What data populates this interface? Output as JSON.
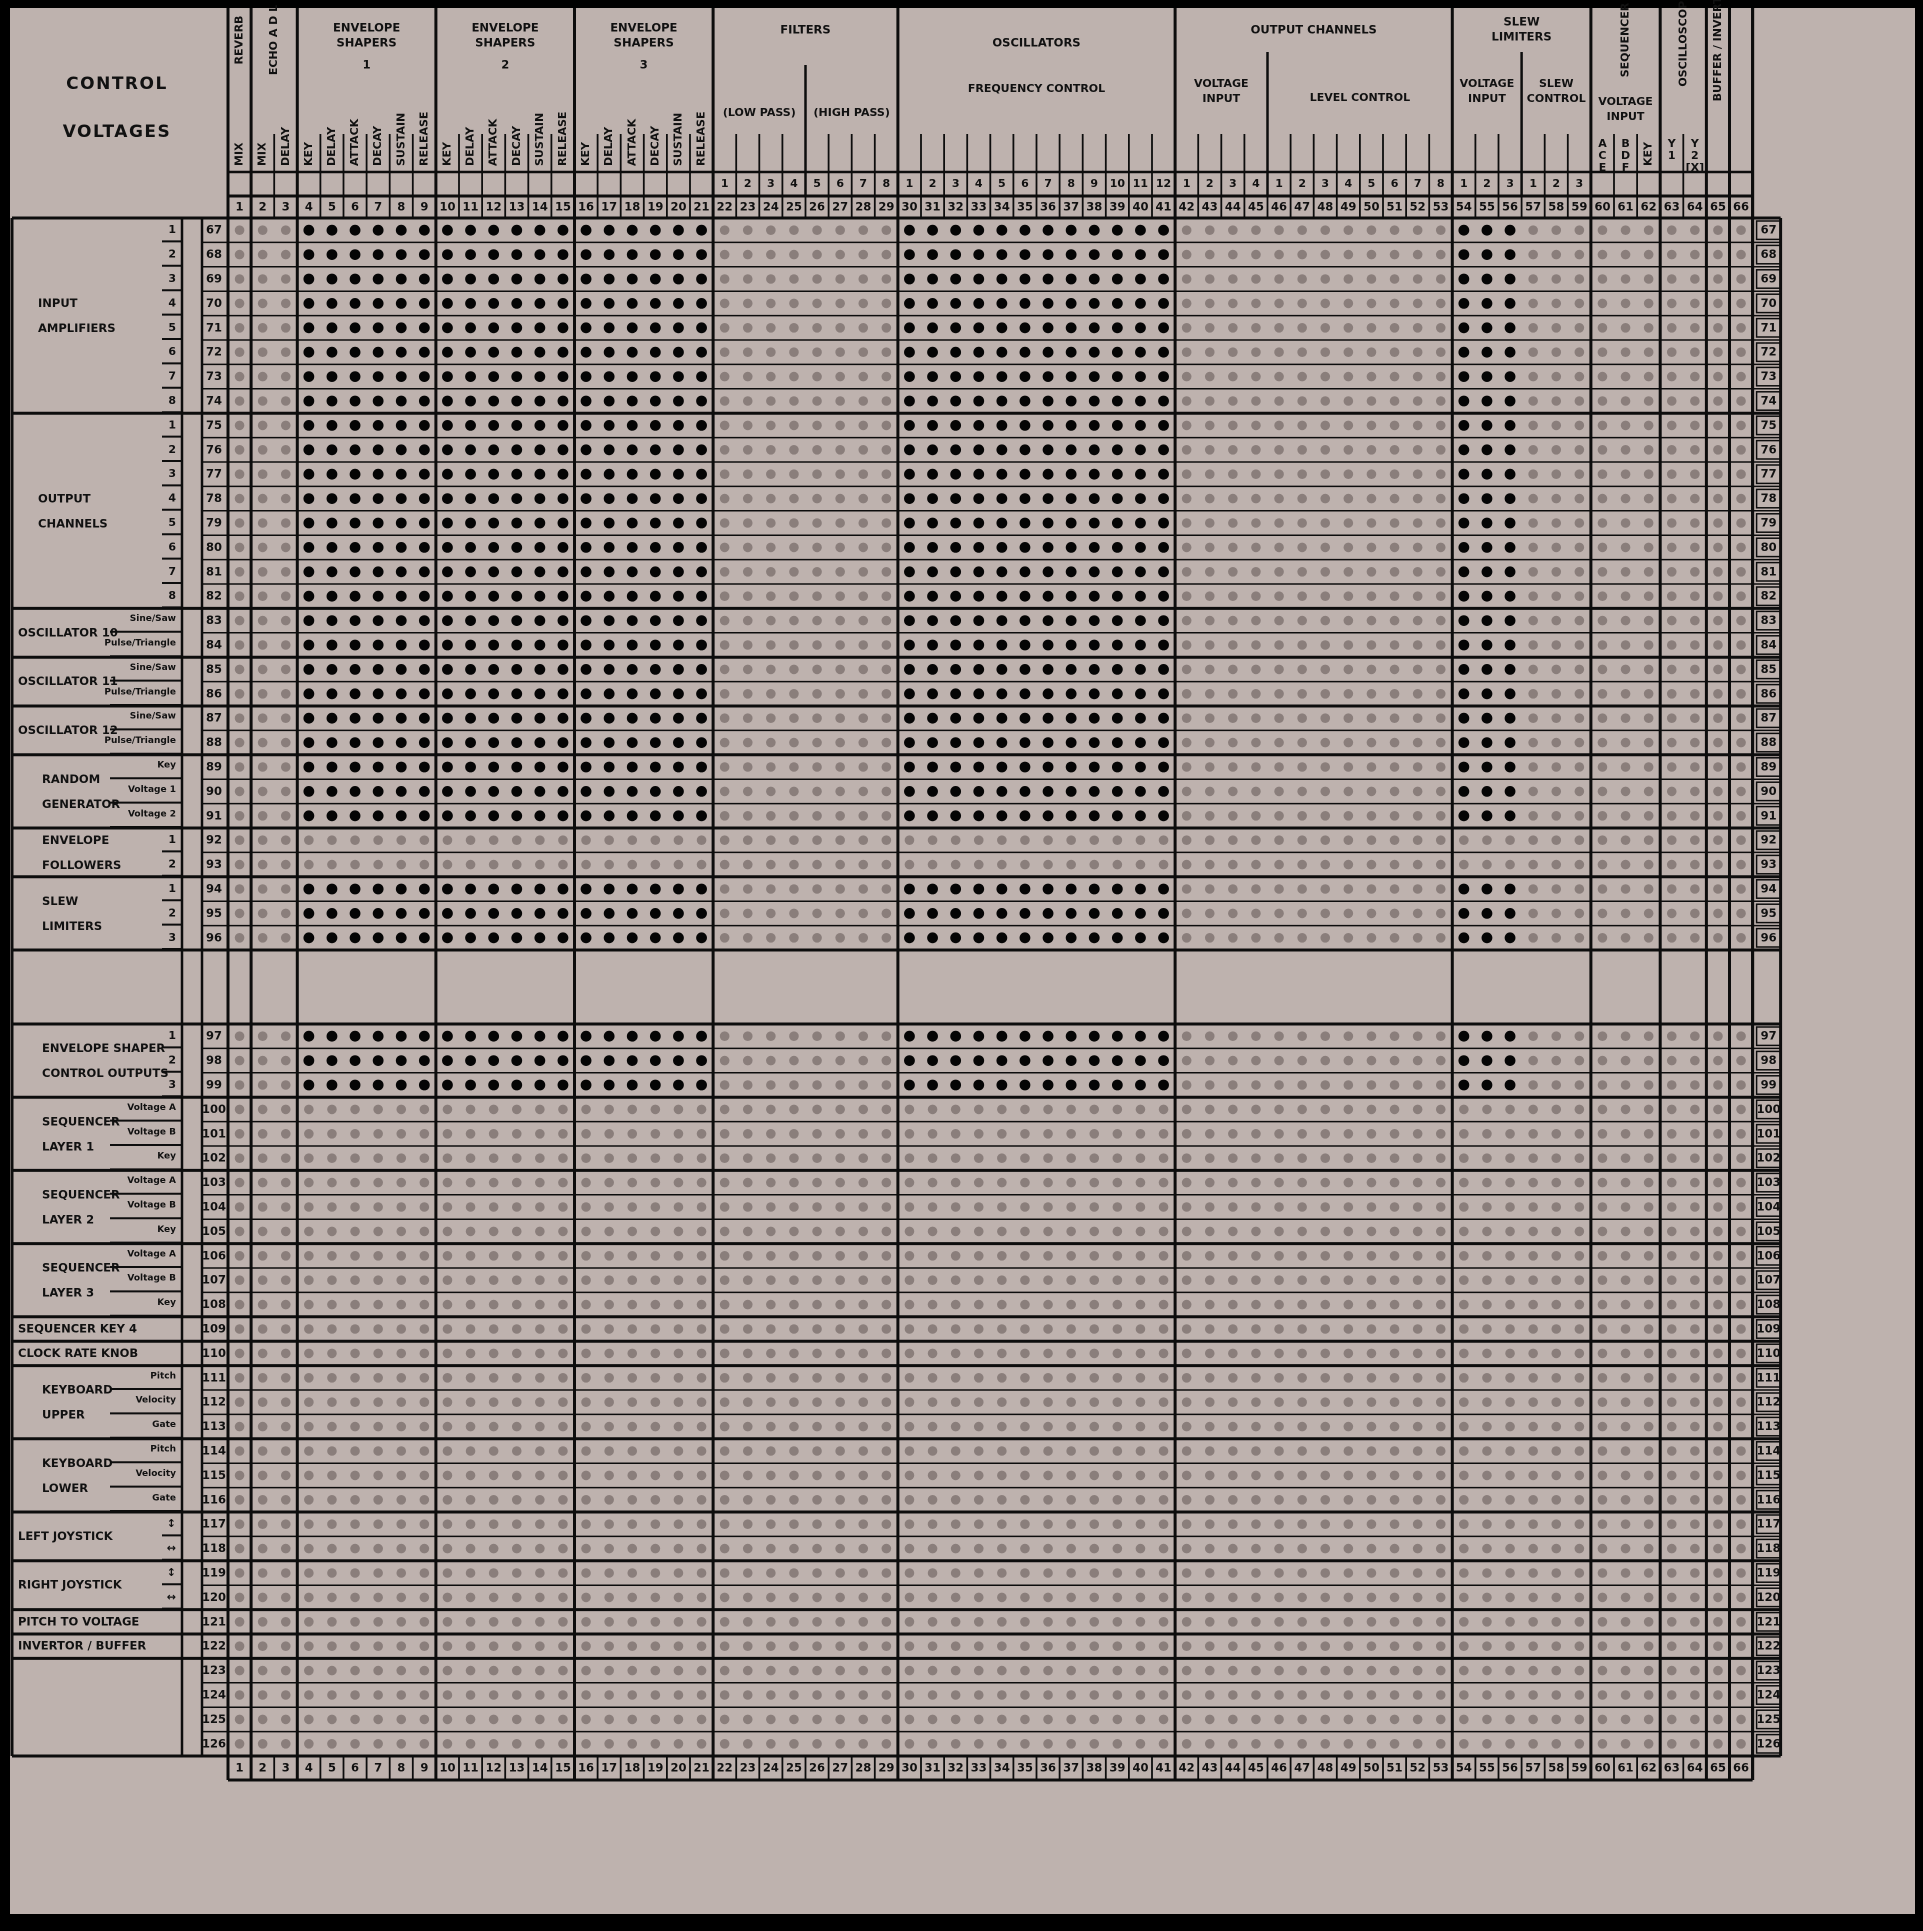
{
  "title": [
    "CONTROL",
    "VOLTAGES"
  ],
  "colors": {
    "panel": "#beb2ae",
    "line": "#0d0d0d",
    "active_pin": "#050505",
    "inactive_pin": "#8a7e7b"
  },
  "column_count": 66,
  "groups": [
    {
      "label": [
        "FILTERS"
      ],
      "cols": [
        22,
        29
      ]
    },
    {
      "label": [
        "OSCILLATORS"
      ],
      "cols": [
        30,
        41
      ]
    },
    {
      "label": [
        "OUTPUT CHANNELS"
      ],
      "cols": [
        42,
        53
      ]
    },
    {
      "label": [
        "SLEW",
        "LIMITERS"
      ],
      "cols": [
        54,
        59
      ]
    },
    {
      "label": [
        "ENVELOPE",
        "SHAPERS",
        "1"
      ],
      "cols": [
        4,
        9
      ]
    },
    {
      "label": [
        "ENVELOPE",
        "SHAPERS",
        "2"
      ],
      "cols": [
        10,
        15
      ]
    },
    {
      "label": [
        "ENVELOPE",
        "SHAPERS",
        "3"
      ],
      "cols": [
        16,
        21
      ]
    }
  ],
  "subgroups": [
    {
      "label": [
        "(LOW PASS)"
      ],
      "cols": [
        22,
        25
      ]
    },
    {
      "label": [
        "(HIGH PASS)"
      ],
      "cols": [
        26,
        29
      ]
    },
    {
      "label": [
        "FREQUENCY CONTROL"
      ],
      "cols": [
        30,
        41
      ]
    },
    {
      "label": [
        "VOLTAGE",
        "INPUT"
      ],
      "cols": [
        42,
        45
      ]
    },
    {
      "label": [
        "LEVEL CONTROL"
      ],
      "cols": [
        46,
        53
      ]
    },
    {
      "label": [
        "VOLTAGE",
        "INPUT"
      ],
      "cols": [
        54,
        56
      ]
    },
    {
      "label": [
        "SLEW",
        "CONTROL"
      ],
      "cols": [
        57,
        59
      ]
    },
    {
      "label": [
        "VOLTAGE",
        "INPUT"
      ],
      "cols": [
        60,
        62
      ]
    }
  ],
  "vertical_group_labels": [
    {
      "text": "REVERB",
      "cols": [
        1,
        1
      ]
    },
    {
      "text": "ECHO A D L",
      "cols": [
        2,
        3
      ]
    },
    {
      "text": "SEQUENCER",
      "cols": [
        60,
        62
      ]
    },
    {
      "text": "OSCILLOSCOPE",
      "cols": [
        63,
        64
      ]
    },
    {
      "text": "BUFFER / INVERTOR",
      "cols": [
        65,
        65
      ]
    }
  ],
  "column_labels": [
    "MIX",
    "MIX",
    "DELAY",
    "KEY",
    "DELAY",
    "ATTACK",
    "DECAY",
    "SUSTAIN",
    "RELEASE",
    "KEY",
    "DELAY",
    "ATTACK",
    "DECAY",
    "SUSTAIN",
    "RELEASE",
    "KEY",
    "DELAY",
    "ATTACK",
    "DECAY",
    "SUSTAIN",
    "RELEASE",
    "1",
    "2",
    "3",
    "4",
    "5",
    "6",
    "7",
    "8",
    "1",
    "2",
    "3",
    "4",
    "5",
    "6",
    "7",
    "8",
    "9",
    "10",
    "11",
    "12",
    "1",
    "2",
    "3",
    "4",
    "1",
    "2",
    "3",
    "4",
    "5",
    "6",
    "7",
    "8",
    "1",
    "2",
    "3",
    "1",
    "2",
    "3",
    "A C E",
    "B D F",
    "KEY",
    "Y 1",
    "Y 2 [X]",
    "",
    ""
  ],
  "column_numbers": [
    "1",
    "2",
    "3",
    "4",
    "5",
    "6",
    "7",
    "8",
    "9",
    "10",
    "11",
    "12",
    "13",
    "14",
    "15",
    "16",
    "17",
    "18",
    "19",
    "20",
    "21",
    "22",
    "23",
    "24",
    "25",
    "26",
    "27",
    "28",
    "29",
    "30",
    "31",
    "32",
    "33",
    "34",
    "35",
    "36",
    "37",
    "38",
    "39",
    "40",
    "41",
    "42",
    "43",
    "44",
    "45",
    "46",
    "47",
    "48",
    "49",
    "50",
    "51",
    "52",
    "53",
    "54",
    "55",
    "56",
    "57",
    "58",
    "59",
    "60",
    "61",
    "62",
    "63",
    "64",
    "65",
    "66"
  ],
  "sections": [
    {
      "name": [
        "INPUT",
        "AMPLIFIERS"
      ],
      "rows": [
        {
          "sub": "1",
          "num": "67"
        },
        {
          "sub": "2",
          "num": "68"
        },
        {
          "sub": "3",
          "num": "69"
        },
        {
          "sub": "4",
          "num": "70"
        },
        {
          "sub": "5",
          "num": "71"
        },
        {
          "sub": "6",
          "num": "72"
        },
        {
          "sub": "7",
          "num": "73"
        },
        {
          "sub": "8",
          "num": "74"
        }
      ],
      "active": true
    },
    {
      "name": [
        "OUTPUT",
        "CHANNELS"
      ],
      "rows": [
        {
          "sub": "1",
          "num": "75"
        },
        {
          "sub": "2",
          "num": "76"
        },
        {
          "sub": "3",
          "num": "77"
        },
        {
          "sub": "4",
          "num": "78"
        },
        {
          "sub": "5",
          "num": "79"
        },
        {
          "sub": "6",
          "num": "80"
        },
        {
          "sub": "7",
          "num": "81"
        },
        {
          "sub": "8",
          "num": "82"
        }
      ],
      "active": true
    },
    {
      "name": [
        "OSCILLATOR 10"
      ],
      "rows": [
        {
          "sub": "Sine/Saw",
          "num": "83"
        },
        {
          "sub": "Pulse/Triangle",
          "num": "84"
        }
      ],
      "active": true
    },
    {
      "name": [
        "OSCILLATOR 11"
      ],
      "rows": [
        {
          "sub": "Sine/Saw",
          "num": "85"
        },
        {
          "sub": "Pulse/Triangle",
          "num": "86"
        }
      ],
      "active": true
    },
    {
      "name": [
        "OSCILLATOR 12"
      ],
      "rows": [
        {
          "sub": "Sine/Saw",
          "num": "87"
        },
        {
          "sub": "Pulse/Triangle",
          "num": "88"
        }
      ],
      "active": true
    },
    {
      "name": [
        "RANDOM",
        "GENERATOR"
      ],
      "rows": [
        {
          "sub": "Key",
          "num": "89"
        },
        {
          "sub": "Voltage 1",
          "num": "90"
        },
        {
          "sub": "Voltage 2",
          "num": "91"
        }
      ],
      "active": true
    },
    {
      "name": [
        "ENVELOPE",
        "FOLLOWERS"
      ],
      "rows": [
        {
          "sub": "1",
          "num": "92"
        },
        {
          "sub": "2",
          "num": "93"
        }
      ],
      "active": false
    },
    {
      "name": [
        "SLEW",
        "LIMITERS"
      ],
      "rows": [
        {
          "sub": "1",
          "num": "94"
        },
        {
          "sub": "2",
          "num": "95"
        },
        {
          "sub": "3",
          "num": "96"
        }
      ],
      "active": true
    },
    {
      "name": [],
      "rows": [],
      "blank": true
    },
    {
      "name": [
        "ENVELOPE SHAPER",
        "CONTROL OUTPUTS"
      ],
      "rows": [
        {
          "sub": "1",
          "num": "97"
        },
        {
          "sub": "2",
          "num": "98"
        },
        {
          "sub": "3",
          "num": "99"
        }
      ],
      "active": true
    },
    {
      "name": [
        "SEQUENCER",
        "LAYER 1"
      ],
      "rows": [
        {
          "sub": "Voltage A",
          "num": "100"
        },
        {
          "sub": "Voltage B",
          "num": "101"
        },
        {
          "sub": "Key",
          "num": "102"
        }
      ],
      "active": false
    },
    {
      "name": [
        "SEQUENCER",
        "LAYER 2"
      ],
      "rows": [
        {
          "sub": "Voltage A",
          "num": "103"
        },
        {
          "sub": "Voltage B",
          "num": "104"
        },
        {
          "sub": "Key",
          "num": "105"
        }
      ],
      "active": false
    },
    {
      "name": [
        "SEQUENCER",
        "LAYER 3"
      ],
      "rows": [
        {
          "sub": "Voltage A",
          "num": "106"
        },
        {
          "sub": "Voltage B",
          "num": "107"
        },
        {
          "sub": "Key",
          "num": "108"
        }
      ],
      "active": false
    },
    {
      "name": [
        "SEQUENCER KEY 4"
      ],
      "rows": [
        {
          "sub": "",
          "num": "109"
        }
      ],
      "active": false
    },
    {
      "name": [
        "CLOCK RATE KNOB"
      ],
      "rows": [
        {
          "sub": "",
          "num": "110"
        }
      ],
      "active": false
    },
    {
      "name": [
        "KEYBOARD",
        "UPPER"
      ],
      "rows": [
        {
          "sub": "Pitch",
          "num": "111"
        },
        {
          "sub": "Velocity",
          "num": "112"
        },
        {
          "sub": "Gate",
          "num": "113"
        }
      ],
      "active": false
    },
    {
      "name": [
        "KEYBOARD",
        "LOWER"
      ],
      "rows": [
        {
          "sub": "Pitch",
          "num": "114"
        },
        {
          "sub": "Velocity",
          "num": "115"
        },
        {
          "sub": "Gate",
          "num": "116"
        }
      ],
      "active": false
    },
    {
      "name": [
        "LEFT JOYSTICK"
      ],
      "rows": [
        {
          "sub": "↕",
          "num": "117"
        },
        {
          "sub": "↔",
          "num": "118"
        }
      ],
      "active": false
    },
    {
      "name": [
        "RIGHT JOYSTICK"
      ],
      "rows": [
        {
          "sub": "↕",
          "num": "119"
        },
        {
          "sub": "↔",
          "num": "120"
        }
      ],
      "active": false
    },
    {
      "name": [
        "PITCH TO VOLTAGE"
      ],
      "rows": [
        {
          "sub": "",
          "num": "121"
        }
      ],
      "active": false
    },
    {
      "name": [
        "INVERTOR / BUFFER"
      ],
      "rows": [
        {
          "sub": "",
          "num": "122"
        }
      ],
      "active": false
    },
    {
      "name": [],
      "rows": [
        {
          "sub": "",
          "num": "123"
        },
        {
          "sub": "",
          "num": "124"
        },
        {
          "sub": "",
          "num": "125"
        },
        {
          "sub": "",
          "num": "126"
        }
      ],
      "active": false
    }
  ],
  "active_columns": [
    4,
    5,
    6,
    7,
    8,
    9,
    10,
    11,
    12,
    13,
    14,
    15,
    16,
    17,
    18,
    19,
    20,
    21,
    30,
    31,
    32,
    33,
    34,
    35,
    36,
    37,
    38,
    39,
    40,
    41,
    54,
    55,
    56
  ]
}
